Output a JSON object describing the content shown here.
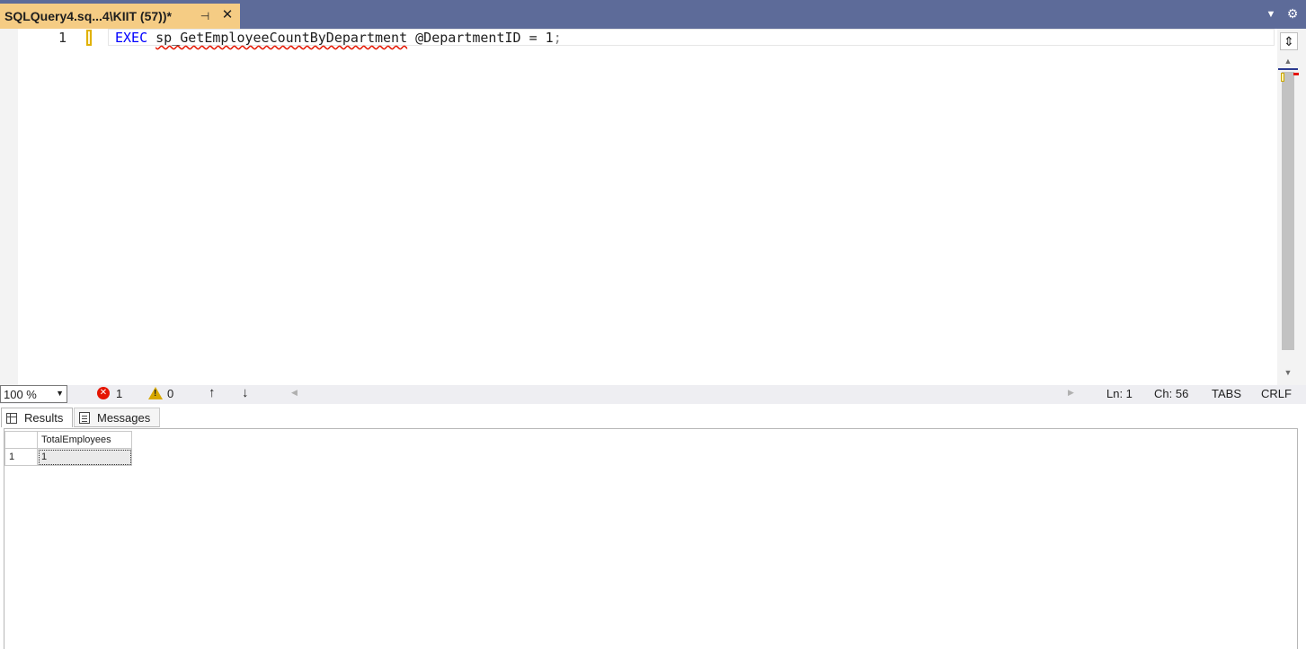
{
  "document_tab": {
    "title": "SQLQuery4.sq...4\\KIIT (57))*",
    "pin_glyph": "⊣",
    "close_glyph": "✕"
  },
  "tabbar_icons": {
    "dropdown": "chevron-down-icon",
    "settings": "gear-icon"
  },
  "editor": {
    "line_number": "1",
    "code": {
      "keyword": "EXEC",
      "procedure": "sp_GetEmployeeCountByDepartment",
      "parameter": "@DepartmentID = 1",
      "terminator": ";"
    }
  },
  "status": {
    "zoom": "100 %",
    "errors": "1",
    "warnings": "0",
    "ln": "Ln: 1",
    "ch": "Ch: 56",
    "indent": "TABS",
    "line_ending": "CRLF"
  },
  "result_tabs": [
    {
      "label": "Results"
    },
    {
      "label": "Messages"
    }
  ],
  "results_grid": {
    "columns": [
      "TotalEmployees"
    ],
    "rows": [
      {
        "row_number": "1",
        "cells": [
          "1"
        ]
      }
    ]
  },
  "colors": {
    "tabbar": "#5d6b99",
    "active_tab": "#f5cc84",
    "keyword": "#0000ff",
    "error": "#e51400",
    "warning": "#d8a800"
  }
}
